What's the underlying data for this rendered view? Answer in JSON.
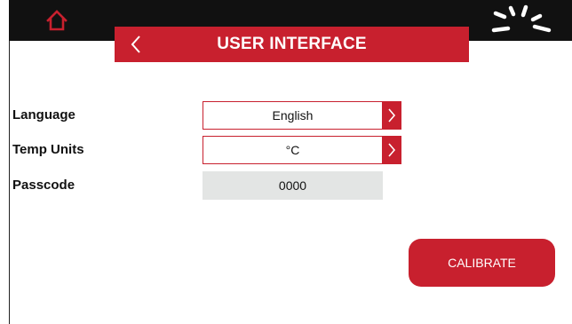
{
  "header": {
    "title": "USER INTERFACE",
    "home_icon": "home-icon",
    "back_icon": "chevron-left-icon",
    "logo_icon": "burst-logo"
  },
  "settings": {
    "language": {
      "label": "Language",
      "value": "English",
      "icon": "chevron-right-icon"
    },
    "temp_units": {
      "label": "Temp Units",
      "value": "°C",
      "icon": "chevron-right-icon"
    },
    "passcode": {
      "label": "Passcode",
      "value": "0000"
    }
  },
  "actions": {
    "calibrate_label": "CALIBRATE"
  },
  "colors": {
    "accent": "#c8202e",
    "topbar": "#111111",
    "input_bg": "#e3e5e4"
  }
}
